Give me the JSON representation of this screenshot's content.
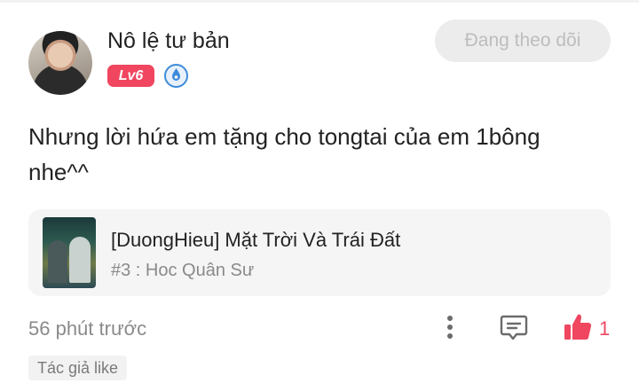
{
  "user": {
    "name": "Nô lệ tư bản",
    "level": "Lv6"
  },
  "follow_button": {
    "label": "Đang theo dõi"
  },
  "comment": {
    "text": "Nhưng lời hứa em tặng cho tongtai của em 1bông nhe^^"
  },
  "book": {
    "title": "[DuongHieu] Mặt Trời Và Trái Đất",
    "chapter": "#3 : Hoc Quân Sư"
  },
  "footer": {
    "timestamp": "56 phút trước",
    "like_count": "1",
    "author_like_label": "Tác giả like"
  },
  "colors": {
    "accent": "#f0465f",
    "badge_blue": "#3d8bd9",
    "muted_text": "#8a8a8a"
  },
  "icons": [
    "avatar",
    "vip-badge-icon",
    "more-icon",
    "reply-icon",
    "like-icon"
  ]
}
